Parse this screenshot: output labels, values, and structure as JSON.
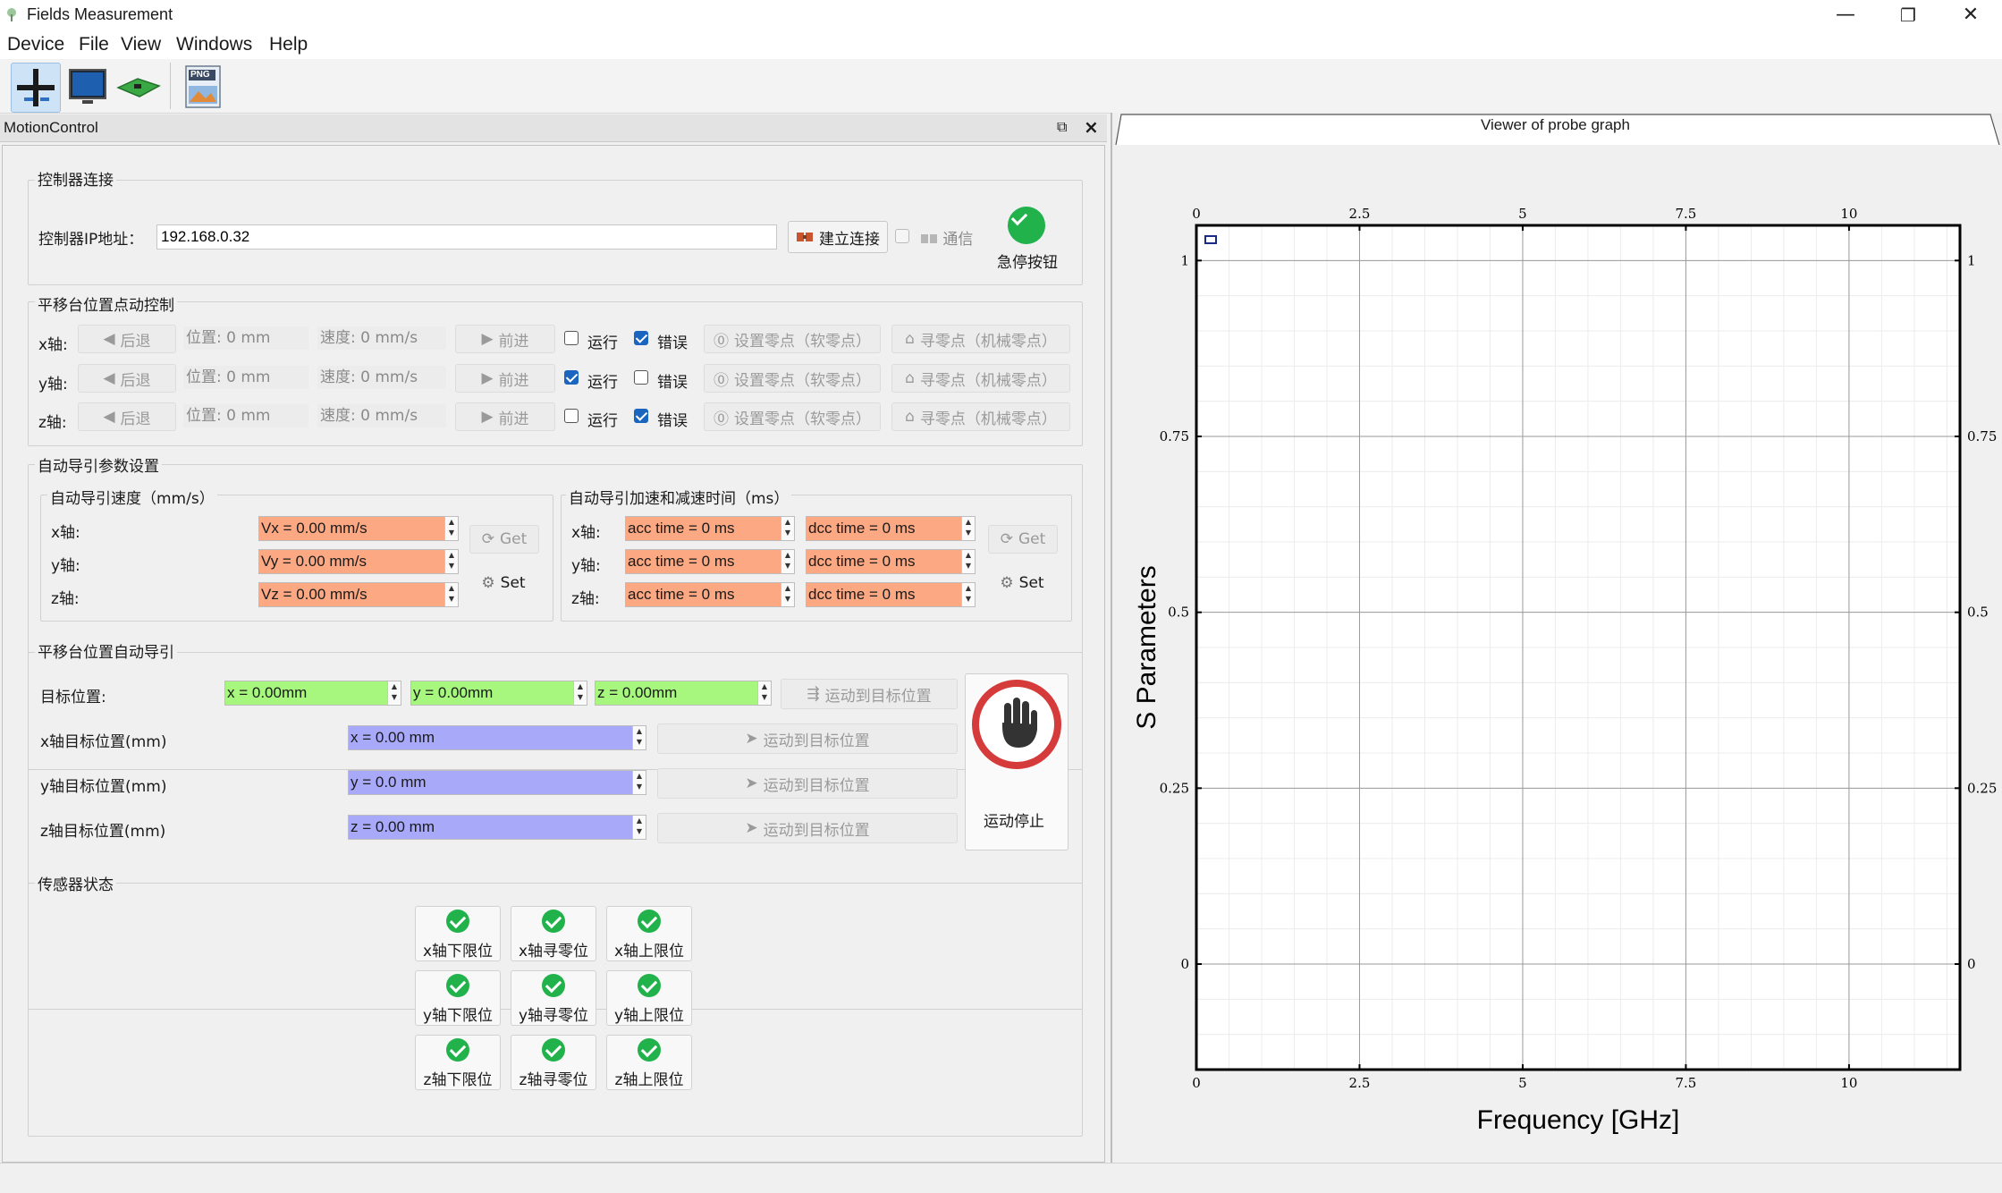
{
  "window": {
    "title": "Fields Measurement",
    "minimize": "—",
    "maximize": "❐",
    "close": "✕"
  },
  "menu": [
    "Device",
    "File",
    "View",
    "Windows",
    "Help"
  ],
  "toolbar": {
    "png_label": "PNG"
  },
  "dock": {
    "title": "MotionControl"
  },
  "controller": {
    "group_title": "控制器连接",
    "ip_label": "控制器IP地址：",
    "ip_value": "192.168.0.32",
    "connect_label": "建立连接",
    "comm_label": "通信",
    "estop_label": "急停按钮"
  },
  "jog": {
    "group_title": "平移台位置点动控制",
    "rows": [
      {
        "axis": "x轴:",
        "back": "后退",
        "pos": "位置: 0 mm",
        "speed": "速度: 0 mm/s",
        "fwd": "前进",
        "run": "运行",
        "run_checked": false,
        "err": "错误",
        "err_checked": true,
        "setzero": "设置零点（软零点）",
        "findzero": "寻零点（机械零点）"
      },
      {
        "axis": "y轴:",
        "back": "后退",
        "pos": "位置: 0 mm",
        "speed": "速度: 0 mm/s",
        "fwd": "前进",
        "run": "运行",
        "run_checked": true,
        "err": "错误",
        "err_checked": false,
        "setzero": "设置零点（软零点）",
        "findzero": "寻零点（机械零点）"
      },
      {
        "axis": "z轴:",
        "back": "后退",
        "pos": "位置: 0 mm",
        "speed": "速度: 0 mm/s",
        "fwd": "前进",
        "run": "运行",
        "run_checked": false,
        "err": "错误",
        "err_checked": true,
        "setzero": "设置零点（软零点）",
        "findzero": "寻零点（机械零点）"
      }
    ]
  },
  "autoparams": {
    "group_title": "自动导引参数设置",
    "speed_title": "自动导引速度（mm/s）",
    "accel_title": "自动导引加速和减速时间（ms）",
    "speed_rows": [
      {
        "axis": "x轴:",
        "value": "Vx = 0.00 mm/s"
      },
      {
        "axis": "y轴:",
        "value": "Vy = 0.00 mm/s"
      },
      {
        "axis": "z轴:",
        "value": "Vz = 0.00 mm/s"
      }
    ],
    "accel_rows": [
      {
        "axis": "x轴:",
        "acc": "acc time = 0 ms",
        "dcc": "dcc time = 0 ms"
      },
      {
        "axis": "y轴:",
        "acc": "acc time = 0 ms",
        "dcc": "dcc time = 0 ms"
      },
      {
        "axis": "z轴:",
        "acc": "acc time = 0 ms",
        "dcc": "dcc time = 0 ms"
      }
    ],
    "get_label": "Get",
    "set_label": "Set"
  },
  "autoguide": {
    "group_title": "平移台位置自动导引",
    "target_label": "目标位置:",
    "target_x": "x = 0.00mm",
    "target_y": "y = 0.00mm",
    "target_z": "z = 0.00mm",
    "move_all": "运动到目标位置",
    "axis_rows": [
      {
        "label": "x轴目标位置(mm)",
        "value": "x = 0.00 mm",
        "move": "运动到目标位置"
      },
      {
        "label": "y轴目标位置(mm)",
        "value": "y = 0.0 mm",
        "move": "运动到目标位置"
      },
      {
        "label": "z轴目标位置(mm)",
        "value": "z = 0.00 mm",
        "move": "运动到目标位置"
      }
    ],
    "stop_label": "运动停止"
  },
  "sensors": {
    "group_title": "传感器状态",
    "items": [
      "x轴下限位",
      "x轴寻零位",
      "x轴上限位",
      "y轴下限位",
      "y轴寻零位",
      "y轴上限位",
      "z轴下限位",
      "z轴寻零位",
      "z轴上限位"
    ]
  },
  "graph": {
    "panel_title": "Viewer of probe graph"
  },
  "chart_data": {
    "type": "line",
    "title": "",
    "xlabel": "Frequency [GHz]",
    "ylabel": "S Parameters",
    "xlim": [
      0,
      11.7
    ],
    "ylim": [
      -0.15,
      1.05
    ],
    "xticks": [
      0,
      2.5,
      5,
      7.5,
      10
    ],
    "xtick_labels": [
      "0",
      "2.5",
      "5",
      "7.5",
      "10"
    ],
    "yticks": [
      0,
      0.25,
      0.5,
      0.75,
      1
    ],
    "ytick_labels": [
      "0",
      "0.25",
      "0.5",
      "0.75",
      "1"
    ],
    "grid": true,
    "series": [],
    "legend": "top-left"
  }
}
